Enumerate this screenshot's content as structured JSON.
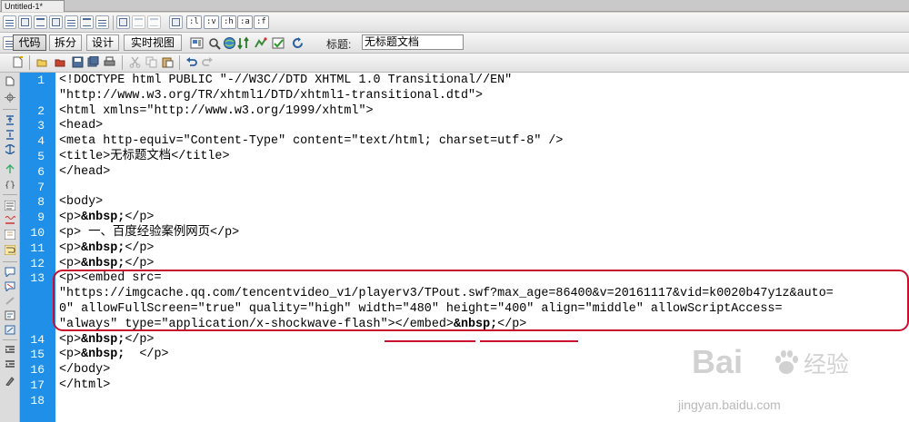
{
  "document_tab": {
    "title": "Untitled-1*"
  },
  "toolbar_row1": {
    "text_buttons": [
      ":l",
      ":v",
      ":h",
      ":a",
      ":f"
    ]
  },
  "toolbar_row2": {
    "views": [
      {
        "label": "代码",
        "active": true
      },
      {
        "label": "拆分",
        "active": false
      },
      {
        "label": "设计",
        "active": false
      },
      {
        "label": "实时视图",
        "active": false
      }
    ],
    "title_label": "标题:",
    "title_value": "无标题文档"
  },
  "editor": {
    "lines": [
      {
        "num": "1",
        "text": "<!DOCTYPE html PUBLIC \"-//W3C//DTD XHTML 1.0 Transitional//EN\""
      },
      {
        "num": "",
        "text": "\"http://www.w3.org/TR/xhtml1/DTD/xhtml1-transitional.dtd\">"
      },
      {
        "num": "2",
        "text": "<html xmlns=\"http://www.w3.org/1999/xhtml\">"
      },
      {
        "num": "3",
        "text": "<head>"
      },
      {
        "num": "4",
        "text": "<meta http-equiv=\"Content-Type\" content=\"text/html; charset=utf-8\" />"
      },
      {
        "num": "5",
        "text": "<title>无标题文档</title>"
      },
      {
        "num": "6",
        "text": "</head>"
      },
      {
        "num": "7",
        "text": ""
      },
      {
        "num": "8",
        "text": "<body>"
      },
      {
        "num": "9",
        "text": "<p>&nbsp;</p>"
      },
      {
        "num": "10",
        "text": "<p> 一、百度经验案例网页</p>"
      },
      {
        "num": "11",
        "text": "<p>&nbsp;</p>"
      },
      {
        "num": "12",
        "text": "<p>&nbsp;</p>"
      },
      {
        "num": "13",
        "text": "<p><embed src="
      },
      {
        "num": "",
        "text": "\"https://imgcache.qq.com/tencentvideo_v1/playerv3/TPout.swf?max_age=86400&v=20161117&vid=k0020b47y1z&auto="
      },
      {
        "num": "",
        "text": "0\" allowFullScreen=\"true\" quality=\"high\" width=\"480\" height=\"400\" align=\"middle\" allowScriptAccess="
      },
      {
        "num": "",
        "text": "\"always\" type=\"application/x-shockwave-flash\"></embed>&nbsp;</p>"
      },
      {
        "num": "14",
        "text": "<p>&nbsp;</p>"
      },
      {
        "num": "15",
        "text": "<p>&nbsp;  </p>"
      },
      {
        "num": "16",
        "text": "</body>"
      },
      {
        "num": "17",
        "text": "</html>"
      },
      {
        "num": "18",
        "text": ""
      }
    ]
  },
  "watermark": {
    "brand": "Bai",
    "brand_suffix": "经验",
    "url": "jingyan.baidu.com"
  },
  "colors": {
    "gutter": "#1f8fe8",
    "annotation_red": "#c8102e"
  }
}
